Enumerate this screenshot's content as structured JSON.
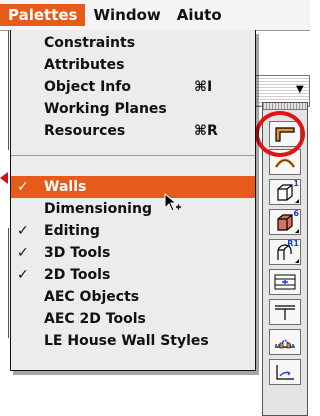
{
  "menubar": {
    "items": [
      {
        "label": "Palettes",
        "active": true
      },
      {
        "label": "Window",
        "active": false
      },
      {
        "label": "Aiuto",
        "active": false
      }
    ]
  },
  "menu": {
    "group1": [
      {
        "label": "Constraints",
        "checked": false,
        "shortcut": ""
      },
      {
        "label": "Attributes",
        "checked": false,
        "shortcut": ""
      },
      {
        "label": "Object Info",
        "checked": false,
        "shortcut": "⌘I"
      },
      {
        "label": "Working Planes",
        "checked": false,
        "shortcut": ""
      },
      {
        "label": "Resources",
        "checked": false,
        "shortcut": "⌘R"
      }
    ],
    "group2": [
      {
        "label": "Walls",
        "checked": true,
        "shortcut": "",
        "selected": true
      },
      {
        "label": "Dimensioning",
        "checked": false,
        "shortcut": ""
      },
      {
        "label": "Editing",
        "checked": true,
        "shortcut": ""
      },
      {
        "label": "3D Tools",
        "checked": true,
        "shortcut": ""
      },
      {
        "label": "2D Tools",
        "checked": true,
        "shortcut": ""
      },
      {
        "label": "AEC Objects",
        "checked": false,
        "shortcut": ""
      },
      {
        "label": "AEC 2D Tools",
        "checked": false,
        "shortcut": ""
      },
      {
        "label": "LE House Wall Styles",
        "checked": false,
        "shortcut": ""
      }
    ],
    "check_glyph": "✓"
  },
  "palette": {
    "tools": [
      {
        "icon": "wall-tool-icon",
        "badge": ""
      },
      {
        "icon": "arc-wall-icon",
        "badge": ""
      },
      {
        "icon": "column-icon",
        "badge": "1"
      },
      {
        "icon": "floor-icon",
        "badge": "6"
      },
      {
        "icon": "roof-icon",
        "badge": "R1"
      },
      {
        "icon": "window-icon",
        "badge": ""
      },
      {
        "icon": "door-icon",
        "badge": ""
      },
      {
        "icon": "wall-join-icon",
        "badge": ""
      },
      {
        "icon": "stair-icon",
        "badge": ""
      }
    ]
  },
  "colors": {
    "menu_highlight": "#e65a1a",
    "annotation_red": "#e01414",
    "badge_blue": "#1b3cd0"
  }
}
